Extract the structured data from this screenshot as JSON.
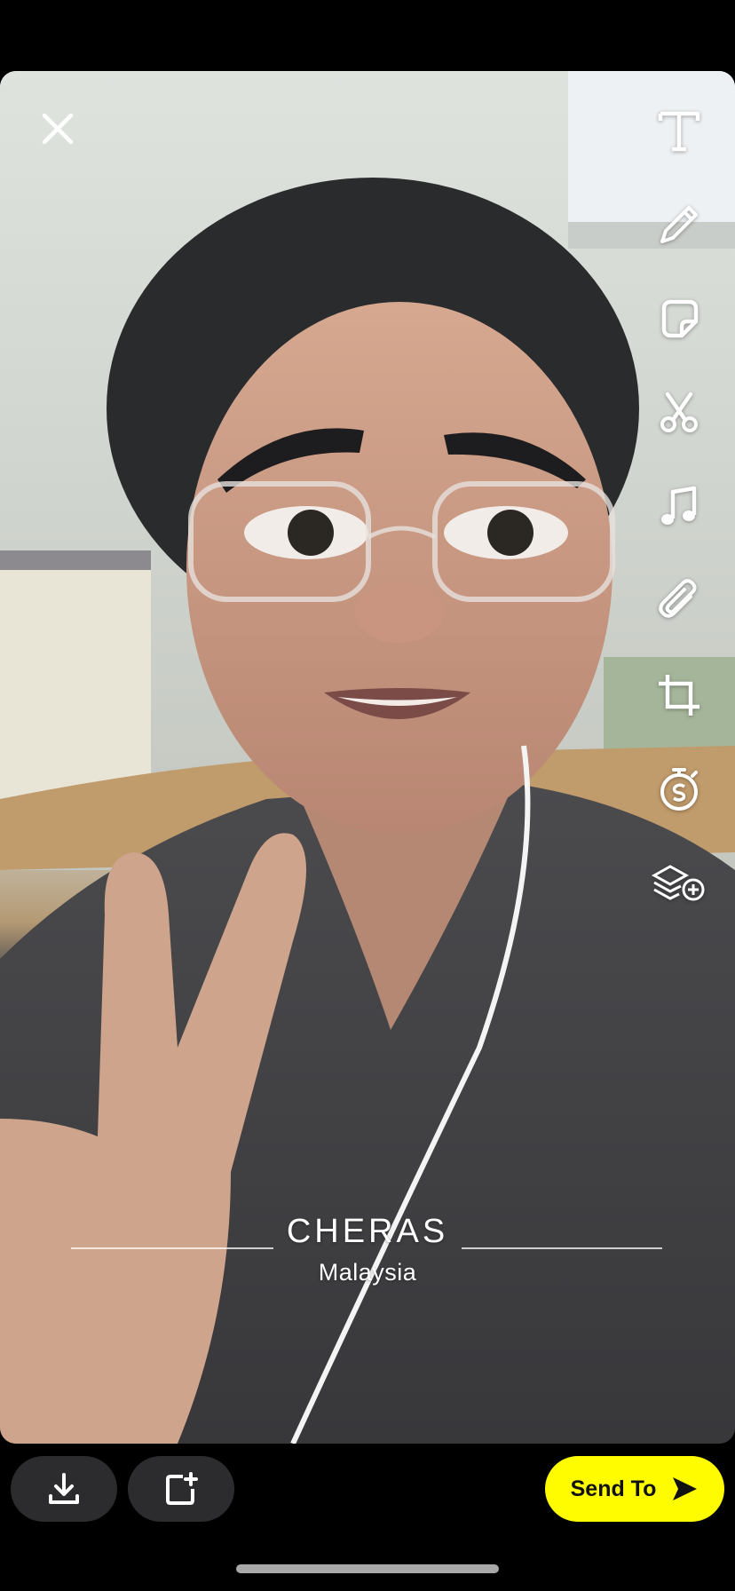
{
  "geofilter": {
    "city": "CHERAS",
    "country": "Malaysia"
  },
  "toolbar": {
    "icons": [
      "text-icon",
      "pencil-icon",
      "sticker-icon",
      "scissors-icon",
      "music-icon",
      "paperclip-icon",
      "crop-icon",
      "timer-icon",
      "layers-add-icon"
    ]
  },
  "actions": {
    "send_label": "Send To",
    "close_icon": "close-icon",
    "save_icon": "download-icon",
    "story_icon": "add-story-icon",
    "send_icon": "send-arrow-icon"
  },
  "colors": {
    "send_button": "#fffc00",
    "pill_background": "#2c2c2e",
    "background": "#000000"
  }
}
